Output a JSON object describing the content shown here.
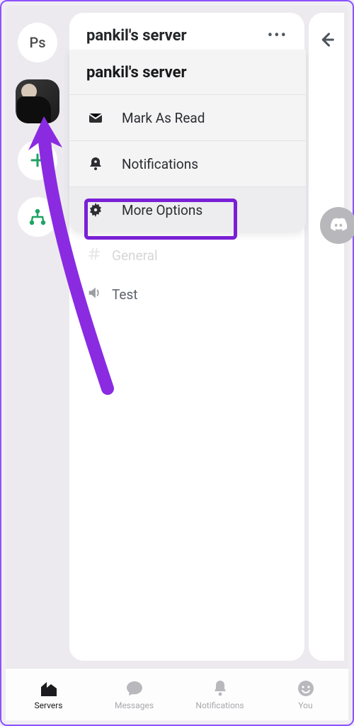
{
  "rail": {
    "ps_label": "Ps"
  },
  "header": {
    "title": "pankil's server"
  },
  "sheet": {
    "title": "pankil's server",
    "mark_read": "Mark As Read",
    "notifications": "Notifications",
    "more_options": "More Options"
  },
  "channels": {
    "general": "General",
    "test": "Test"
  },
  "nav": {
    "servers": "Servers",
    "messages": "Messages",
    "notifications": "Notifications",
    "you": "You"
  }
}
